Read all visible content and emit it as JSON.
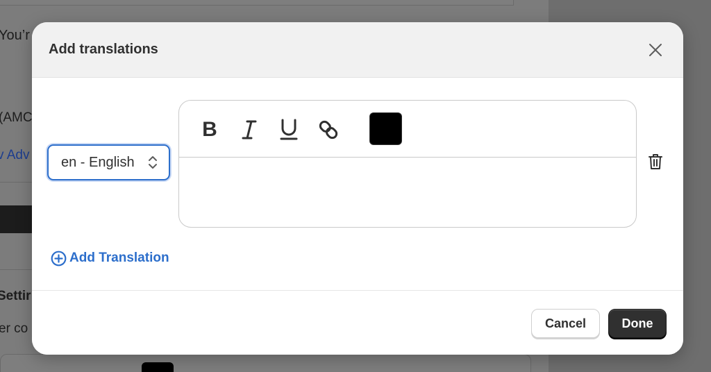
{
  "background": {
    "texts": [
      "You’r",
      "(AMC",
      "v Adv",
      "Settir",
      "er co"
    ]
  },
  "modal": {
    "title": "Add translations",
    "language_select": {
      "value": "en - English"
    },
    "editor": {
      "tools": [
        "bold-icon",
        "italic-icon",
        "underline-icon",
        "link-icon"
      ],
      "bold_glyph": "B",
      "text_color": "#000000",
      "content": ""
    },
    "add_translation_label": "Add Translation",
    "footer": {
      "cancel_label": "Cancel",
      "done_label": "Done"
    }
  },
  "colors": {
    "accent": "#2c6ecb",
    "primary_button": "#303030"
  }
}
